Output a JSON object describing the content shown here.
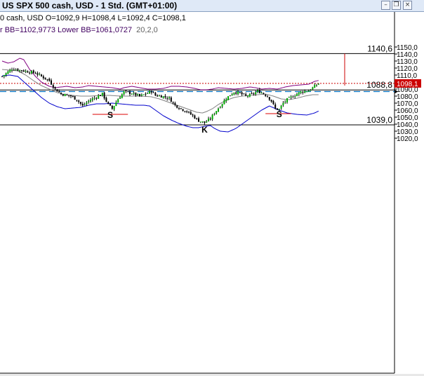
{
  "window": {
    "title": "US SPX 500 cash, USD - 1 Std. (GMT+01:00)",
    "buttons": [
      "minimize-icon",
      "restore-icon",
      "close-icon"
    ]
  },
  "info": {
    "ohlc_line": "0 cash, USD O=1092,9 H=1098,4 L=1092,4 C=1098,1",
    "bb_values": "r BB=1102,9773 Lower BB=1061,0727",
    "bb_params": "20,2,0"
  },
  "chart_data": {
    "type": "candlestick",
    "y_axis_side": "right",
    "ylim": [
      1016,
      1162
    ],
    "y_ticks": [
      "1150,0",
      "1140,0",
      "1130,0",
      "1120,0",
      "1110,0",
      "1100,0",
      "1090,0",
      "1080,0",
      "1070,0",
      "1060,0",
      "1050,0",
      "1040,0",
      "1030,0",
      "1020,0"
    ],
    "current_price_label": "1098,1",
    "levels": [
      {
        "label": "1140,6",
        "value": 1140.6
      },
      {
        "label": "1088,8",
        "value": 1088.8
      },
      {
        "label": "1039,0",
        "value": 1039.0
      }
    ],
    "current_price_value": 1098.1,
    "support_dashed_value": 1086.5,
    "pattern_labels": [
      "S",
      "K",
      "S"
    ],
    "colors": {
      "bull": "#00aa00",
      "bear": "#000000",
      "upper_band": "#800080",
      "lower_band": "#0000cc",
      "middle_band": "#808080",
      "current_price": "#cc0000",
      "support_line": "#0070c0",
      "pattern_marker": "#dd0000"
    },
    "close_path": [
      [
        0,
        1108
      ],
      [
        5,
        1119
      ],
      [
        11,
        1116
      ],
      [
        17,
        1113
      ],
      [
        24,
        1102
      ],
      [
        27,
        1090
      ],
      [
        30,
        1083
      ],
      [
        35,
        1080
      ],
      [
        38,
        1075
      ],
      [
        41,
        1066
      ],
      [
        44,
        1073
      ],
      [
        48,
        1079
      ],
      [
        51,
        1083
      ],
      [
        54,
        1068
      ],
      [
        56,
        1062
      ],
      [
        59,
        1076
      ],
      [
        62,
        1086
      ],
      [
        66,
        1084
      ],
      [
        70,
        1080
      ],
      [
        73,
        1083
      ],
      [
        76,
        1087
      ],
      [
        78,
        1081
      ],
      [
        81,
        1080
      ],
      [
        85,
        1077
      ],
      [
        88,
        1067
      ],
      [
        91,
        1062
      ],
      [
        94,
        1058
      ],
      [
        97,
        1052
      ],
      [
        100,
        1045
      ],
      [
        103,
        1042
      ],
      [
        106,
        1048
      ],
      [
        108,
        1056
      ],
      [
        111,
        1066
      ],
      [
        114,
        1077
      ],
      [
        118,
        1086
      ],
      [
        121,
        1084
      ],
      [
        124,
        1080
      ],
      [
        127,
        1082
      ],
      [
        130,
        1087
      ],
      [
        132,
        1085
      ],
      [
        135,
        1080
      ],
      [
        137,
        1073
      ],
      [
        139,
        1062
      ],
      [
        141,
        1061
      ],
      [
        143,
        1070
      ],
      [
        145,
        1075
      ],
      [
        148,
        1080
      ],
      [
        152,
        1086
      ],
      [
        156,
        1088
      ],
      [
        159,
        1094
      ],
      [
        161,
        1098
      ]
    ],
    "bands": {
      "upper": [
        [
          0,
          1130
        ],
        [
          3,
          1127
        ],
        [
          6,
          1129
        ],
        [
          9,
          1134
        ],
        [
          11,
          1132
        ],
        [
          14,
          1118
        ],
        [
          17,
          1108
        ],
        [
          20,
          1100
        ],
        [
          24,
          1094
        ],
        [
          27,
          1092
        ],
        [
          30,
          1093
        ],
        [
          33,
          1094
        ],
        [
          37,
          1092
        ],
        [
          41,
          1093
        ],
        [
          44,
          1095
        ],
        [
          48,
          1094
        ],
        [
          52,
          1093
        ],
        [
          56,
          1092
        ],
        [
          60,
          1090
        ],
        [
          62,
          1092
        ],
        [
          66,
          1094
        ],
        [
          70,
          1092
        ],
        [
          74,
          1090
        ],
        [
          78,
          1090
        ],
        [
          82,
          1091
        ],
        [
          86,
          1094
        ],
        [
          90,
          1094
        ],
        [
          94,
          1093
        ],
        [
          98,
          1091
        ],
        [
          101,
          1089
        ],
        [
          104,
          1089
        ],
        [
          107,
          1090
        ],
        [
          110,
          1092
        ],
        [
          114,
          1091
        ],
        [
          118,
          1090
        ],
        [
          122,
          1091
        ],
        [
          126,
          1093
        ],
        [
          129,
          1092
        ],
        [
          132,
          1090
        ],
        [
          136,
          1091
        ],
        [
          140,
          1090
        ],
        [
          144,
          1093
        ],
        [
          148,
          1095
        ],
        [
          152,
          1096
        ],
        [
          156,
          1097
        ],
        [
          159,
          1101
        ],
        [
          162,
          1103
        ]
      ],
      "middle": [
        [
          0,
          1118
        ],
        [
          4,
          1117
        ],
        [
          8,
          1116
        ],
        [
          12,
          1110
        ],
        [
          16,
          1102
        ],
        [
          20,
          1095
        ],
        [
          24,
          1090
        ],
        [
          28,
          1085
        ],
        [
          32,
          1082
        ],
        [
          36,
          1081
        ],
        [
          40,
          1080
        ],
        [
          45,
          1080
        ],
        [
          50,
          1081
        ],
        [
          55,
          1081
        ],
        [
          60,
          1080
        ],
        [
          66,
          1080
        ],
        [
          71,
          1080
        ],
        [
          76,
          1079
        ],
        [
          80,
          1076
        ],
        [
          84,
          1072
        ],
        [
          88,
          1068
        ],
        [
          92,
          1064
        ],
        [
          96,
          1060
        ],
        [
          99,
          1057
        ],
        [
          102,
          1056
        ],
        [
          104,
          1058
        ],
        [
          107,
          1062
        ],
        [
          110,
          1068
        ],
        [
          114,
          1074
        ],
        [
          118,
          1078
        ],
        [
          122,
          1080
        ],
        [
          126,
          1081
        ],
        [
          130,
          1082
        ],
        [
          134,
          1083
        ],
        [
          138,
          1080
        ],
        [
          142,
          1076
        ],
        [
          146,
          1075
        ],
        [
          150,
          1077
        ],
        [
          154,
          1080
        ],
        [
          158,
          1082
        ],
        [
          162,
          1082
        ]
      ],
      "lower": [
        [
          0,
          1109
        ],
        [
          4,
          1110
        ],
        [
          8,
          1108
        ],
        [
          12,
          1098
        ],
        [
          16,
          1088
        ],
        [
          20,
          1078
        ],
        [
          24,
          1070
        ],
        [
          28,
          1065
        ],
        [
          32,
          1062
        ],
        [
          36,
          1063
        ],
        [
          40,
          1064
        ],
        [
          44,
          1067
        ],
        [
          48,
          1069
        ],
        [
          52,
          1069
        ],
        [
          56,
          1070
        ],
        [
          60,
          1069
        ],
        [
          64,
          1068
        ],
        [
          68,
          1067
        ],
        [
          72,
          1067
        ],
        [
          75,
          1066
        ],
        [
          78,
          1060
        ],
        [
          82,
          1052
        ],
        [
          86,
          1046
        ],
        [
          90,
          1041
        ],
        [
          94,
          1037
        ],
        [
          97,
          1035
        ],
        [
          100,
          1035
        ],
        [
          103,
          1037
        ],
        [
          106,
          1038
        ],
        [
          108,
          1034
        ],
        [
          111,
          1030
        ],
        [
          115,
          1029
        ],
        [
          119,
          1034
        ],
        [
          124,
          1044
        ],
        [
          128,
          1052
        ],
        [
          132,
          1060
        ],
        [
          136,
          1066
        ],
        [
          140,
          1061
        ],
        [
          145,
          1056
        ],
        [
          150,
          1054
        ],
        [
          155,
          1053
        ],
        [
          159,
          1056
        ],
        [
          162,
          1060
        ]
      ]
    },
    "pattern_markers": [
      {
        "label": "S",
        "y": 1054,
        "from": 46,
        "to": 64
      },
      {
        "label": "K",
        "y": 1033,
        "from": null,
        "to": null
      },
      {
        "label": "S",
        "y": 1055,
        "from": 134,
        "to": 147
      }
    ]
  }
}
